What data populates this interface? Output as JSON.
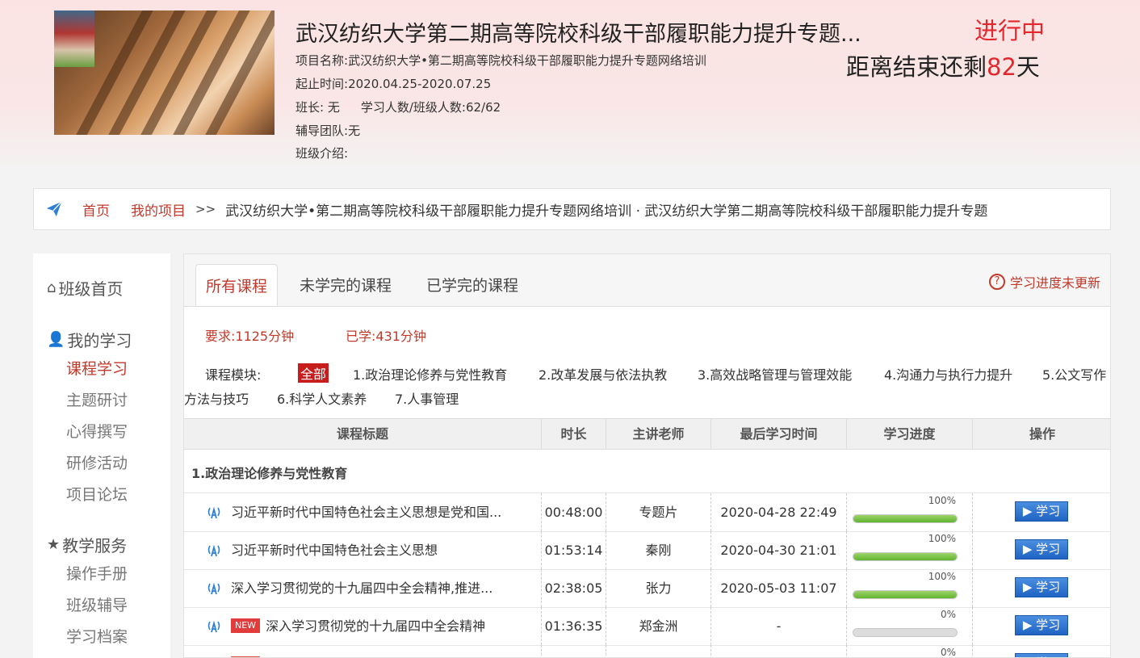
{
  "header": {
    "title": "武汉纺织大学第二期高等院校科级干部履职能力提升专题...",
    "status": "进行中",
    "countdown_prefix": "距离结束还剩",
    "countdown_days": "82",
    "countdown_suffix": "天",
    "project_name_label": "项目名称:",
    "project_name": "武汉纺织大学•第二期高等院校科级干部履职能力提升专题网络培训",
    "period_label": "起止时间:",
    "period": "2020.04.25-2020.07.25",
    "monitor_label": "班长:",
    "monitor": "无",
    "students_label": "学习人数/班级人数:",
    "students": "62/62",
    "team_label": "辅导团队:",
    "team": "无",
    "intro_label": "班级介绍:"
  },
  "breadcrumb": {
    "home": "首页",
    "my_projects": "我的项目",
    "separator": ">>",
    "current": "武汉纺织大学•第二期高等院校科级干部履职能力提升专题网络培训 · 武汉纺织大学第二期高等院校科级干部履职能力提升专题"
  },
  "sidebar": {
    "class_home": "班级首页",
    "my_study": "我的学习",
    "study_items": [
      "课程学习",
      "主题研讨",
      "心得撰写",
      "研修活动",
      "项目论坛"
    ],
    "services": "教学服务",
    "service_items": [
      "操作手册",
      "班级辅导",
      "学习档案"
    ]
  },
  "tabs": [
    "所有课程",
    "未学完的课程",
    "已学完的课程"
  ],
  "progress_note": "学习进度未更新",
  "requirement": "要求:1125分钟",
  "studied": "已学:431分钟",
  "modules": {
    "label": "课程模块:",
    "items": [
      "全部",
      "1.政治理论修养与党性教育",
      "2.改革发展与依法执教",
      "3.高效战略管理与管理效能",
      "4.沟通力与执行力提升",
      "5.公文写作",
      "方法与技巧",
      "6.科学人文素养",
      "7.人事管理"
    ]
  },
  "table": {
    "headers": [
      "课程标题",
      "时长",
      "主讲老师",
      "最后学习时间",
      "学习进度",
      "操作"
    ],
    "section": "1.政治理论修养与党性教育",
    "button_label": "学习",
    "new_label": "NEW",
    "rows": [
      {
        "title": "习近平新时代中国特色社会主义思想是党和国...",
        "duration": "00:48:00",
        "teacher": "专题片",
        "last": "2020-04-28 22:49",
        "progress": "100%",
        "fill": 1.0,
        "is_new": false
      },
      {
        "title": "习近平新时代中国特色社会主义思想",
        "duration": "01:53:14",
        "teacher": "秦刚",
        "last": "2020-04-30 21:01",
        "progress": "100%",
        "fill": 1.0,
        "is_new": false
      },
      {
        "title": "深入学习贯彻党的十九届四中全会精神,推进...",
        "duration": "02:38:05",
        "teacher": "张力",
        "last": "2020-05-03 11:07",
        "progress": "100%",
        "fill": 1.0,
        "is_new": false
      },
      {
        "title": "深入学习贯彻党的十九届四中全会精神",
        "duration": "01:36:35",
        "teacher": "郑金洲",
        "last": "-",
        "progress": "0%",
        "fill": 0.0,
        "is_new": true
      },
      {
        "title": "",
        "duration": "",
        "teacher": "",
        "last": "",
        "progress": "0%",
        "fill": 0.0,
        "is_new": true
      }
    ]
  },
  "colors": {
    "accent": "#c0392b",
    "button": "#2a6fd0",
    "progress": "#6cbf3a"
  }
}
